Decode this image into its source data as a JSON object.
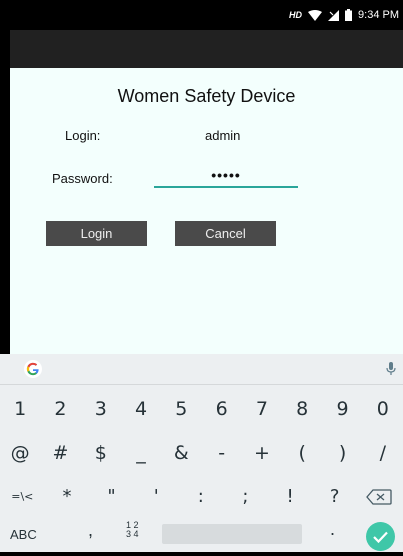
{
  "status_bar": {
    "network": "HD",
    "time": "9:34 PM"
  },
  "form": {
    "title": "Women Safety Device",
    "login_label": "Login:",
    "login_value": "admin",
    "password_label": "Password:",
    "password_value": "•••••",
    "login_button": "Login",
    "cancel_button": "Cancel"
  },
  "keyboard": {
    "row_numbers": [
      "1",
      "2",
      "3",
      "4",
      "5",
      "6",
      "7",
      "8",
      "9",
      "0"
    ],
    "row_symbols1": [
      "@",
      "#",
      "$",
      "_",
      "&",
      "-",
      "+",
      "(",
      ")",
      "/"
    ],
    "row_symbols2": [
      "=\\<",
      "*",
      "\"",
      "'",
      ":",
      ";",
      "!",
      "?"
    ],
    "abc_label": "ABC",
    "comma": ",",
    "numpad_top": "1 2",
    "numpad_bottom": "3 4",
    "period": ".",
    "accent_color": "#3fc7a8"
  }
}
